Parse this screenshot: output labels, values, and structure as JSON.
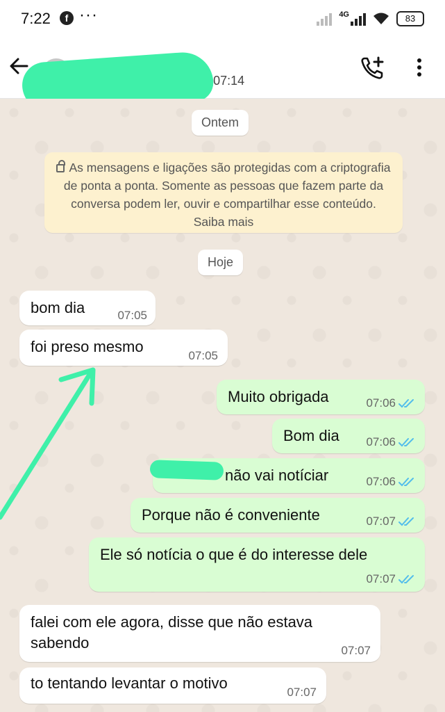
{
  "status_bar": {
    "time": "7:22",
    "fb_icon": "facebook-icon",
    "dots": "···",
    "network": "4G",
    "battery": "83"
  },
  "header": {
    "last_seen": "visto por último hoje às 07:14",
    "icons": [
      "back-arrow-icon",
      "add-call-icon",
      "more-vert-icon"
    ]
  },
  "chat": {
    "date_yesterday": "Ontem",
    "encryption_notice": "As mensagens e ligações são protegidas com a criptografia de ponta a ponta. Somente as pessoas que fazem parte da conversa podem ler, ouvir e compartilhar esse conteúdo. Saiba mais",
    "date_today": "Hoje",
    "messages": [
      {
        "dir": "in",
        "text": "bom dia",
        "time": "07:05"
      },
      {
        "dir": "in",
        "text": "foi preso mesmo",
        "time": "07:05"
      },
      {
        "dir": "out",
        "text": "Muito obrigada",
        "time": "07:06",
        "read": true
      },
      {
        "dir": "out",
        "text": "Bom dia",
        "time": "07:06",
        "read": true
      },
      {
        "dir": "out",
        "text": "não vai notíciar",
        "time": "07:06",
        "read": true
      },
      {
        "dir": "out",
        "text": "Porque não é conveniente",
        "time": "07:07",
        "read": true
      },
      {
        "dir": "out",
        "text": "Ele só notícia o que é do interesse dele",
        "time": "07:07",
        "read": true
      },
      {
        "dir": "in",
        "text": "falei com ele agora, disse que não estava",
        "text2": "sabendo",
        "time": "07:07"
      },
      {
        "dir": "in",
        "text": "to tentando levantar o motivo",
        "time": "07:07"
      }
    ]
  },
  "colors": {
    "incoming_bubble": "#ffffff",
    "outgoing_bubble": "#d9fdd3",
    "chat_background": "#efe7de",
    "read_ticks": "#53bdeb",
    "annotation": "#3ff0a9"
  }
}
